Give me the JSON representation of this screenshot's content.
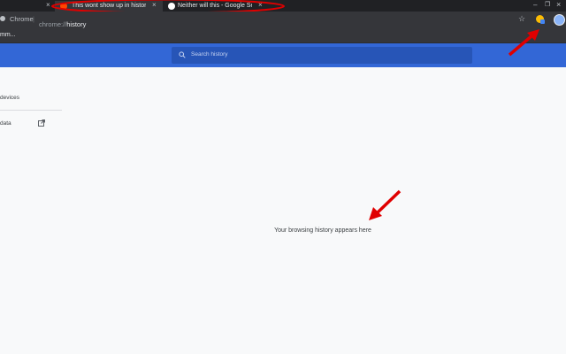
{
  "tabs": [
    {
      "title": "This wont show up in history",
      "close": "×"
    },
    {
      "title": "Neither will this - Google Search",
      "close": "×"
    }
  ],
  "first_tab_close": "×",
  "toolbar": {
    "site_label": "Chrome",
    "separator": "|",
    "url_scheme": "chrome://",
    "url_path": "history",
    "star_icon": "☆"
  },
  "bookmarks": {
    "partial_item": "mm..."
  },
  "header": {
    "search_placeholder": "Search history"
  },
  "sidebar": {
    "items": [
      {
        "label": "devices"
      },
      {
        "label": "data"
      }
    ]
  },
  "main": {
    "empty_message": "Your browsing history appears here"
  },
  "window_controls": {
    "minimize": "–",
    "restore": "❐",
    "close": "×"
  },
  "colors": {
    "annotation": "#e00000",
    "header_blue": "#3367d6"
  }
}
